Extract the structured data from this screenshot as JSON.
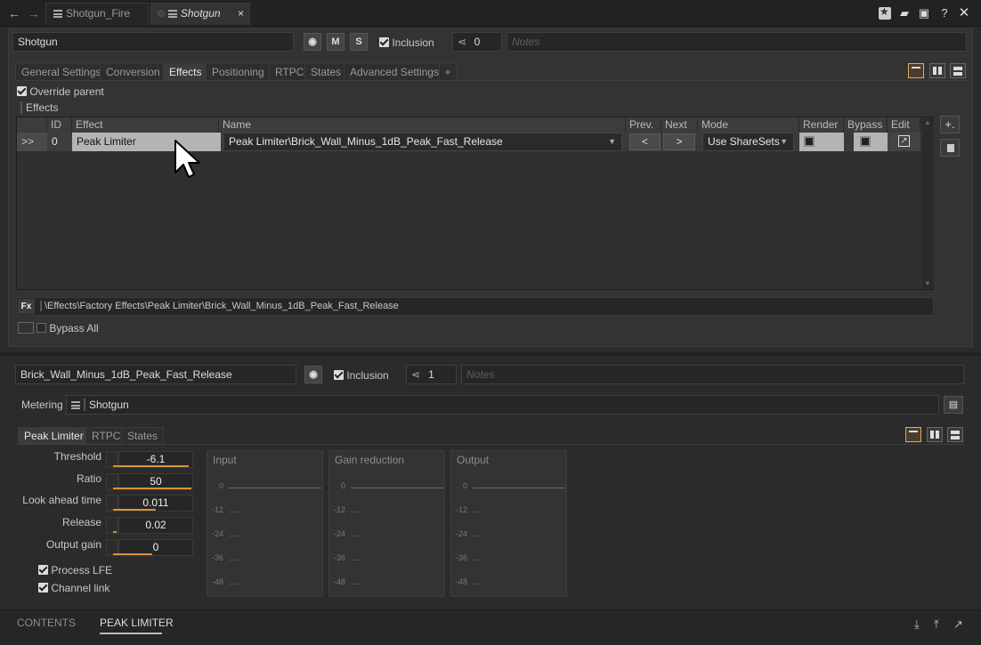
{
  "titlebar": {
    "back_icon": "arrow-left-icon",
    "forward_icon": "arrow-right-icon",
    "tabs": [
      {
        "label": "Shotgun_Fire",
        "active": false
      },
      {
        "label": "Shotgun",
        "active": true
      }
    ],
    "close_glyph": "×"
  },
  "object": {
    "name": "Shotgun",
    "mute_label": "M",
    "solo_label": "S",
    "inclusion_label": "Inclusion",
    "share_count": "0",
    "notes_placeholder": "Notes"
  },
  "tabs": [
    "General Settings",
    "Conversion",
    "Effects",
    "Positioning",
    "RTPC",
    "States",
    "Advanced Settings",
    "+"
  ],
  "active_tab": "Effects",
  "effects": {
    "override_parent_label": "Override parent",
    "section_label": "Effects",
    "columns": [
      "ID",
      "Effect",
      "Name",
      "Prev.",
      "Next",
      "Mode",
      "Render",
      "Bypass",
      "Edit"
    ],
    "rows": [
      {
        "expand": ">>",
        "id": "0",
        "effect": "Peak Limiter",
        "name": "Peak Limiter\\Brick_Wall_Minus_1dB_Peak_Fast_Release",
        "prev": "<",
        "next": ">",
        "mode": "Use ShareSets"
      }
    ],
    "path": "\\Effects\\Factory Effects\\Peak Limiter\\Brick_Wall_Minus_1dB_Peak_Fast_Release",
    "fx_label": "Fx",
    "bypass_all_label": "Bypass All",
    "add_label": "+."
  },
  "effect_editor": {
    "name": "Brick_Wall_Minus_1dB_Peak_Fast_Release",
    "inclusion_label": "Inclusion",
    "share_count": "1",
    "notes_placeholder": "Notes",
    "metering_label": "Metering",
    "metering_target": "Shotgun",
    "tabs": [
      "Peak Limiter",
      "RTPC",
      "States"
    ],
    "active_tab": "Peak Limiter",
    "params": [
      {
        "label": "Threshold",
        "value": "-6.1",
        "fill": 0.97
      },
      {
        "label": "Ratio",
        "value": "50",
        "fill": 1.0
      },
      {
        "label": "Look ahead time",
        "value": "0.011",
        "fill": 0.55
      },
      {
        "label": "Release",
        "value": "0.02",
        "fill": 0.05
      },
      {
        "label": "Output gain",
        "value": "0",
        "fill": 0.5
      }
    ],
    "process_lfe_label": "Process LFE",
    "channel_link_label": "Channel link",
    "meters": [
      {
        "title": "Input"
      },
      {
        "title": "Gain reduction"
      },
      {
        "title": "Output"
      }
    ],
    "meter_ticks": [
      "0",
      "-12",
      "-24",
      "-36",
      "-48"
    ]
  },
  "bottom_tabs": [
    "CONTENTS",
    "PEAK LIMITER"
  ],
  "active_bottom_tab": "PEAK LIMITER",
  "colors": {
    "accent": "#e8a857",
    "background": "#2b2b2b"
  }
}
